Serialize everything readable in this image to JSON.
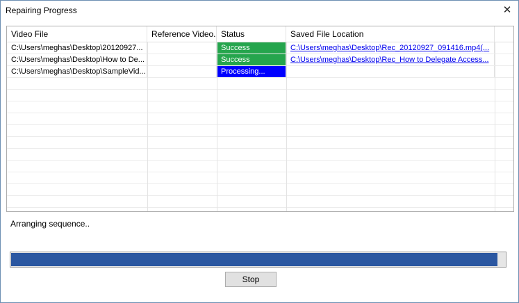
{
  "window": {
    "title": "Repairing Progress",
    "close_glyph": "✕"
  },
  "table": {
    "columns": [
      "Video File",
      "Reference Video...",
      "Status",
      "Saved File Location"
    ],
    "rows": [
      {
        "video_file": "C:\\Users\\meghas\\Desktop\\20120927...",
        "reference": "",
        "status": "Success",
        "status_color": "#25a54d",
        "location": "C:\\Users\\meghas\\Desktop\\Rec_20120927_091416.mp4(..."
      },
      {
        "video_file": "C:\\Users\\meghas\\Desktop\\How to De...",
        "reference": "",
        "status": "Success",
        "status_color": "#25a54d",
        "location": "C:\\Users\\meghas\\Desktop\\Rec_How to Delegate Access..."
      },
      {
        "video_file": "C:\\Users\\meghas\\Desktop\\SampleVid...",
        "reference": "",
        "status": "Processing...",
        "status_color": "#0000ff",
        "location": ""
      }
    ]
  },
  "status_message": "Arranging sequence..",
  "progress": {
    "fraction": 0.985,
    "color": "#2b57a1"
  },
  "buttons": {
    "stop_label": "Stop"
  }
}
